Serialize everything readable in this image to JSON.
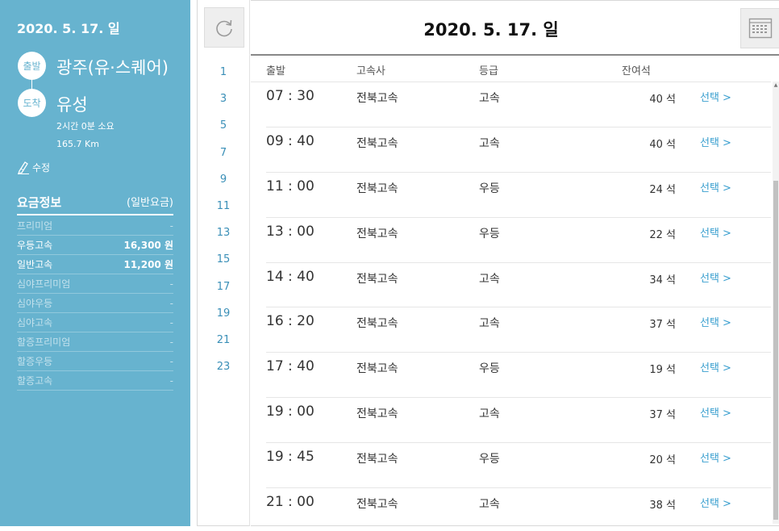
{
  "sidebar": {
    "date": "2020. 5. 17. 일",
    "departure_badge": "출발",
    "departure_name": "광주(유·스퀘어)",
    "arrival_badge": "도착",
    "arrival_name": "유성",
    "duration": "2시간 0분 소요",
    "distance": "165.7 Km",
    "edit_label": "수정",
    "fare": {
      "title": "요금정보",
      "type": "(일반요금)",
      "rows": [
        {
          "name": "프리미엄",
          "price": "-"
        },
        {
          "name": "우등고속",
          "price": "16,300 원"
        },
        {
          "name": "일반고속",
          "price": "11,200 원"
        },
        {
          "name": "심야프리미엄",
          "price": "-"
        },
        {
          "name": "심야우등",
          "price": "-"
        },
        {
          "name": "심야고속",
          "price": "-"
        },
        {
          "name": "할증프리미엄",
          "price": "-"
        },
        {
          "name": "할증우등",
          "price": "-"
        },
        {
          "name": "할증고속",
          "price": "-"
        }
      ]
    }
  },
  "hours": [
    "1",
    "3",
    "5",
    "7",
    "9",
    "11",
    "13",
    "15",
    "17",
    "19",
    "21",
    "23"
  ],
  "main": {
    "title": "2020. 5. 17. 일",
    "columns": {
      "departure": "출발",
      "company": "고속사",
      "grade": "등급",
      "seats": "잔여석"
    },
    "rows": [
      {
        "time": "07 : 30",
        "company": "전북고속",
        "grade": "고속",
        "seats": "40 석",
        "select": "선택 >"
      },
      {
        "time": "09 : 40",
        "company": "전북고속",
        "grade": "고속",
        "seats": "40 석",
        "select": "선택 >"
      },
      {
        "time": "11 : 00",
        "company": "전북고속",
        "grade": "우등",
        "seats": "24 석",
        "select": "선택 >"
      },
      {
        "time": "13 : 00",
        "company": "전북고속",
        "grade": "우등",
        "seats": "22 석",
        "select": "선택 >"
      },
      {
        "time": "14 : 40",
        "company": "전북고속",
        "grade": "고속",
        "seats": "34 석",
        "select": "선택 >"
      },
      {
        "time": "16 : 20",
        "company": "전북고속",
        "grade": "고속",
        "seats": "37 석",
        "select": "선택 >"
      },
      {
        "time": "17 : 40",
        "company": "전북고속",
        "grade": "우등",
        "seats": "19 석",
        "select": "선택 >"
      },
      {
        "time": "19 : 00",
        "company": "전북고속",
        "grade": "고속",
        "seats": "37 석",
        "select": "선택 >"
      },
      {
        "time": "19 : 45",
        "company": "전북고속",
        "grade": "우등",
        "seats": "20 석",
        "select": "선택 >"
      },
      {
        "time": "21 : 00",
        "company": "전북고속",
        "grade": "고속",
        "seats": "38 석",
        "select": "선택 >"
      }
    ]
  },
  "colors": {
    "sidebar_bg": "#67b3cf",
    "link": "#3a9fcf",
    "hour_link": "#3a8fb7"
  },
  "icons": {
    "refresh": "refresh-icon",
    "calendar": "calendar-icon",
    "edit": "edit-pencil-icon"
  }
}
